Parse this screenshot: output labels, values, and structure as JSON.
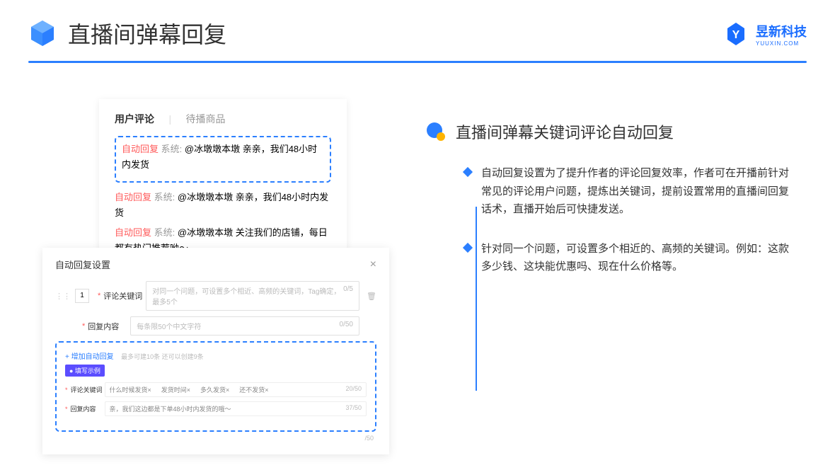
{
  "header": {
    "title": "直播间弹幕回复",
    "brand_name": "昱新科技",
    "brand_sub": "YUUXIN.COM"
  },
  "comments": {
    "tab_active": "用户评论",
    "tab_inactive": "待播商品",
    "auto_label": "自动回复",
    "sys_label": "系统:",
    "row1": "@冰墩墩本墩 亲亲，我们48小时内发货",
    "row2": "@冰墩墩本墩 亲亲，我们48小时内发货",
    "row3": "@冰墩墩本墩 关注我们的店铺，每日都有热门推荐呦～"
  },
  "settings": {
    "title": "自动回复设置",
    "num": "1",
    "kw_label": "评论关键词",
    "kw_placeholder": "对同一个问题，可设置多个相近、高频的关键词，Tag确定，最多5个",
    "kw_counter": "0/5",
    "content_label": "回复内容",
    "content_placeholder": "每条限50个中文字符",
    "content_counter": "0/50",
    "add_label": "+ 增加自动回复",
    "add_hint": "最多可建10条 还可以创建9条",
    "ex_badge": "● 填写示例",
    "ex_kw_label": "评论关键词",
    "ex_kw_chips": "什么时候发货× 　 发货时间× 　 多久发货× 　 还不发货×",
    "ex_kw_counter": "20/50",
    "ex_content_label": "回复内容",
    "ex_content_text": "亲，我们这边都是下单48小时内发货的哦～",
    "ex_content_counter": "37/50",
    "side_counter": "/50"
  },
  "right": {
    "subtitle": "直播间弹幕关键词评论自动回复",
    "b1": "自动回复设置为了提升作者的评论回复效率，作者可在开播前针对常见的评论用户问题，提炼出关键词，提前设置常用的直播间回复话术，直播开始后可快捷发送。",
    "b2": "针对同一个问题，可设置多个相近的、高频的关键词。例如：这款多少钱、这块能优惠吗、现在什么价格等。"
  }
}
